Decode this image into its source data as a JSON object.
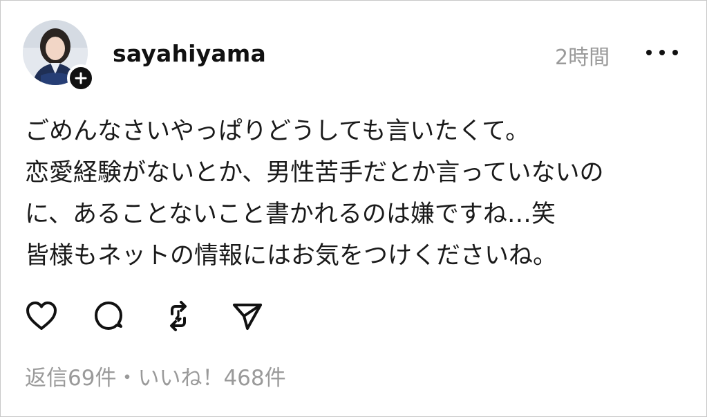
{
  "post": {
    "username": "sayahiyama",
    "timestamp": "2時間",
    "avatar_icon": "profile-photo",
    "follow_icon": "plus-icon",
    "more_icon": "more-horizontal-icon",
    "body_lines": [
      "ごめんなさいやっぱりどうしても言いたくて。",
      "恋愛経験がないとか、男性苦手だとか言っていないの",
      "に、あることないこと書かれるのは嫌ですね…笑",
      "皆様もネットの情報にはお気をつけくださいね。"
    ],
    "actions": {
      "like_icon": "heart-icon",
      "reply_icon": "comment-icon",
      "repost_icon": "repost-icon",
      "share_icon": "send-icon"
    },
    "stats": "返信69件・いいね！468件"
  },
  "colors": {
    "text": "#111111",
    "muted": "#9a9a9a",
    "border": "#c8c8c8"
  }
}
